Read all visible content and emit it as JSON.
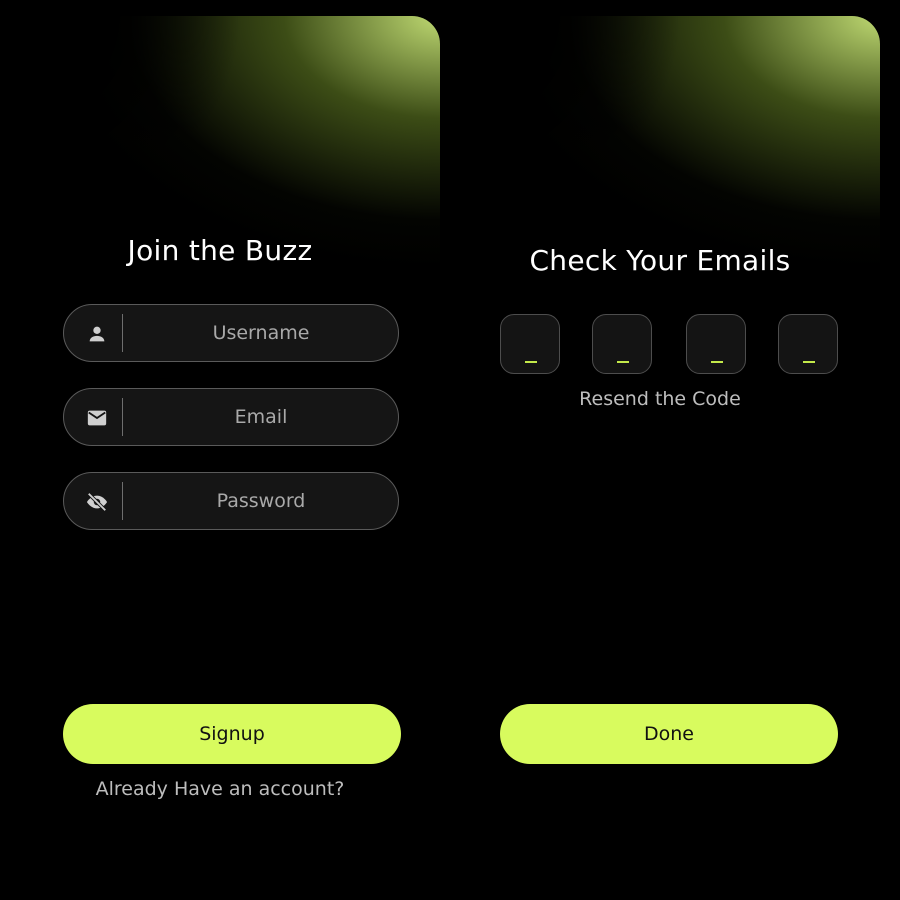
{
  "signup": {
    "title": "Join the Buzz",
    "fields": [
      {
        "placeholder": "Username",
        "icon": "user-icon"
      },
      {
        "placeholder": "Email",
        "icon": "mail-icon"
      },
      {
        "placeholder": "Password",
        "icon": "eye-off-icon"
      }
    ],
    "button_label": "Signup",
    "login_link": "Already Have an account?"
  },
  "verify": {
    "title": "Check Your Emails",
    "code_placeholder": "_",
    "resend_link": "Resend the Code",
    "button_label": "Done"
  },
  "colors": {
    "accent": "#d8fb5e",
    "background": "#000000",
    "field_border": "#5a5a5a"
  }
}
